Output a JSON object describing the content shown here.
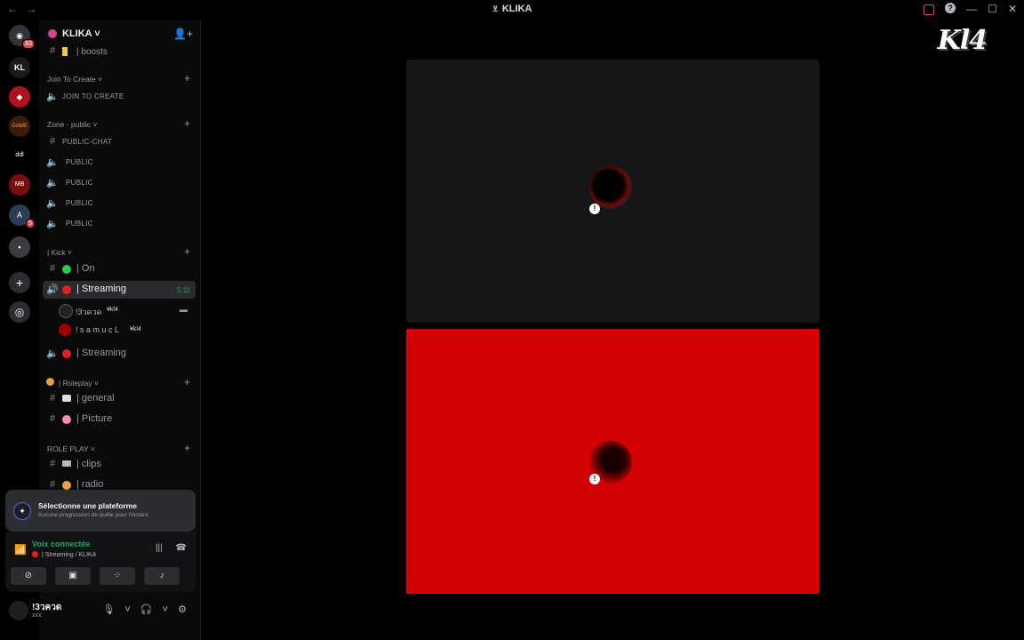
{
  "window": {
    "title": "KLIKA",
    "nav_back": "←",
    "nav_fwd": "→",
    "minimize": "—",
    "maximize": "☐",
    "close": "✕",
    "help": "?"
  },
  "rail": {
    "home_badge": "83",
    "servers": [
      {
        "label": "KL",
        "badge": ""
      },
      {
        "label": "◆",
        "badge": ""
      },
      {
        "label": "GAME",
        "badge": ""
      },
      {
        "label": "ddl",
        "badge": ""
      },
      {
        "label": "MB",
        "badge": ""
      },
      {
        "label": "A",
        "badge": "5"
      },
      {
        "label": "▪",
        "badge": ""
      }
    ],
    "add": "+",
    "explore": "◎"
  },
  "server": {
    "name": "KLIKA ˅",
    "invite": "👤+"
  },
  "channels": {
    "boosts": "| boosts",
    "cat_join": "Join To Create ˅",
    "join": "JOIN TO CREATE",
    "cat_zone": "Zone - public ˅",
    "public_chat": "PUBLIC-CHAT",
    "public": "PUBLIC",
    "cat_kick": "| Kick ˅",
    "on": "| On",
    "streaming": "| Streaming",
    "streaming_time": "5:11",
    "users": [
      {
        "name": "!3วควด",
        "tag": "¥kl4"
      },
      {
        "name": "! s a m u c L",
        "tag": "¥kl4"
      }
    ],
    "streaming2": "| Streaming",
    "cat_roleplay": "| Roleplay ˅",
    "general": "| general",
    "picture": "| Picture",
    "cat_roleplay2": "ROLE PLAY ˅",
    "clips": "| clips",
    "radio": "| radio"
  },
  "quest": {
    "title": "Sélectionne une plateforme",
    "subtitle": "Aucune progression de quête pour l'instant"
  },
  "voice": {
    "status": "Voix connectée",
    "detail": "| Streaming / KLIKA"
  },
  "user": {
    "name": "!3วควด",
    "status": "xxx"
  },
  "main": {
    "brand": "Kl4"
  },
  "colors": {
    "accent_green": "#23a55a",
    "stream_red": "#d30202",
    "badge_red": "#ed4245"
  }
}
